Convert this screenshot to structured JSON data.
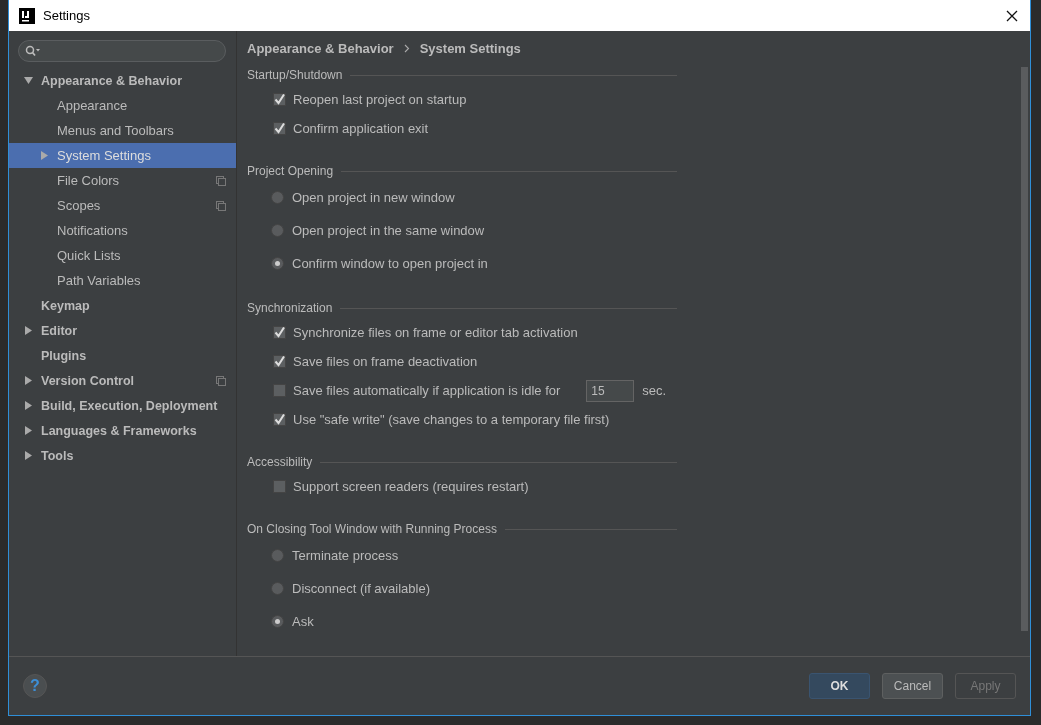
{
  "window": {
    "title": "Settings"
  },
  "tree": [
    {
      "label": "Appearance & Behavior",
      "expanded": true,
      "selected": false,
      "shared_icon": false,
      "children": [
        {
          "label": "Appearance",
          "selected": false,
          "shared_icon": false
        },
        {
          "label": "Menus and Toolbars",
          "selected": false,
          "shared_icon": false
        },
        {
          "label": "System Settings",
          "expanded": false,
          "selected": true,
          "shared_icon": false
        },
        {
          "label": "File Colors",
          "selected": false,
          "shared_icon": true
        },
        {
          "label": "Scopes",
          "selected": false,
          "shared_icon": true
        },
        {
          "label": "Notifications",
          "selected": false,
          "shared_icon": false
        },
        {
          "label": "Quick Lists",
          "selected": false,
          "shared_icon": false
        },
        {
          "label": "Path Variables",
          "selected": false,
          "shared_icon": false
        }
      ]
    },
    {
      "label": "Keymap",
      "selected": false,
      "shared_icon": false
    },
    {
      "label": "Editor",
      "expanded": false,
      "selected": false,
      "shared_icon": false
    },
    {
      "label": "Plugins",
      "selected": false,
      "shared_icon": false
    },
    {
      "label": "Version Control",
      "expanded": false,
      "selected": false,
      "shared_icon": true
    },
    {
      "label": "Build, Execution, Deployment",
      "expanded": false,
      "selected": false,
      "shared_icon": false
    },
    {
      "label": "Languages & Frameworks",
      "expanded": false,
      "selected": false,
      "shared_icon": false
    },
    {
      "label": "Tools",
      "expanded": false,
      "selected": false,
      "shared_icon": false
    }
  ],
  "breadcrumb": [
    "Appearance & Behavior",
    "System Settings"
  ],
  "sections": [
    {
      "title": "Startup/Shutdown",
      "options": [
        {
          "kind": "checkbox",
          "label": "Reopen last project on startup",
          "checked": true
        },
        {
          "kind": "checkbox",
          "label": "Confirm application exit",
          "checked": true
        }
      ]
    },
    {
      "title": "Project Opening",
      "options": [
        {
          "kind": "radio",
          "label": "Open project in new window",
          "selected": false
        },
        {
          "kind": "radio",
          "label": "Open project in the same window",
          "selected": false
        },
        {
          "kind": "radio",
          "label": "Confirm window to open project in",
          "selected": true
        }
      ]
    },
    {
      "title": "Synchronization",
      "options": [
        {
          "kind": "checkbox",
          "label": "Synchronize files on frame or editor tab activation",
          "checked": true
        },
        {
          "kind": "checkbox",
          "label": "Save files on frame deactivation",
          "checked": true
        },
        {
          "kind": "checkbox",
          "label": "Save files automatically if application is idle for",
          "checked": false,
          "value": "15",
          "suffix": "sec."
        },
        {
          "kind": "checkbox",
          "label": "Use \"safe write\" (save changes to a temporary file first)",
          "checked": true
        }
      ]
    },
    {
      "title": "Accessibility",
      "options": [
        {
          "kind": "checkbox",
          "label": "Support screen readers (requires restart)",
          "checked": false
        }
      ]
    },
    {
      "title": "On Closing Tool Window with Running Process",
      "options": [
        {
          "kind": "radio",
          "label": "Terminate process",
          "selected": false
        },
        {
          "kind": "radio",
          "label": "Disconnect (if available)",
          "selected": false
        },
        {
          "kind": "radio",
          "label": "Ask",
          "selected": true
        }
      ]
    }
  ],
  "help": {
    "label": "?"
  },
  "buttons": [
    {
      "label": "OK",
      "kind": "default",
      "disabled": false
    },
    {
      "label": "Cancel",
      "kind": "normal",
      "disabled": false
    },
    {
      "label": "Apply",
      "kind": "normal",
      "disabled": true
    }
  ]
}
